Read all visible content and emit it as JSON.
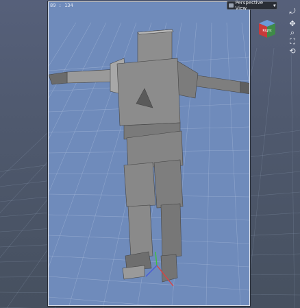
{
  "viewport": {
    "stats": "89 : 134",
    "camera_label": "Perspective View",
    "dropdown_glyph": "▾",
    "menu_glyph": "▾"
  },
  "nav_cube": {
    "face_label": "Right"
  },
  "toolbar": {
    "tools": [
      {
        "name": "frame-icon",
        "glyph": "⤾"
      },
      {
        "name": "pan-icon",
        "glyph": "✥"
      },
      {
        "name": "zoom-icon",
        "glyph": "⌕"
      },
      {
        "name": "fit-icon",
        "glyph": "⛶"
      },
      {
        "name": "reset-icon",
        "glyph": "⟲"
      }
    ]
  },
  "colors": {
    "canvas": "#6f8bbb",
    "figure": "#8a8a8a",
    "axis_x": "#e04040",
    "axis_y": "#3cc03c",
    "axis_z": "#4a5bd6"
  }
}
